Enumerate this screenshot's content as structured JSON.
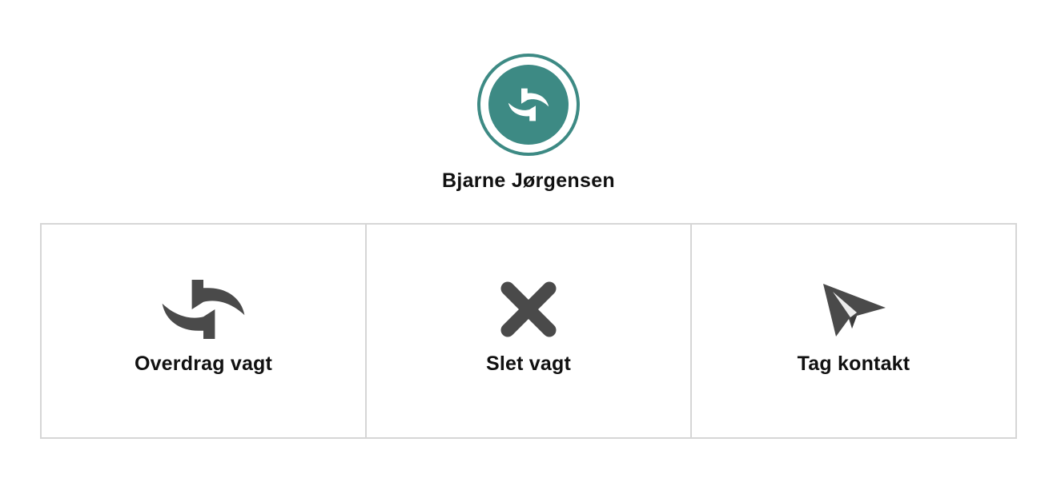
{
  "profile": {
    "name": "Bjarne Jørgensen",
    "avatar_icon": "swap-arrows-icon",
    "accent_color": "#3d8a84"
  },
  "actions": [
    {
      "label": "Overdrag vagt",
      "icon": "swap-arrows-icon"
    },
    {
      "label": "Slet vagt",
      "icon": "close-icon"
    },
    {
      "label": "Tag kontakt",
      "icon": "paper-plane-icon"
    }
  ],
  "colors": {
    "icon": "#4a4a4a",
    "border": "#d6d6d6",
    "text": "#111111"
  }
}
